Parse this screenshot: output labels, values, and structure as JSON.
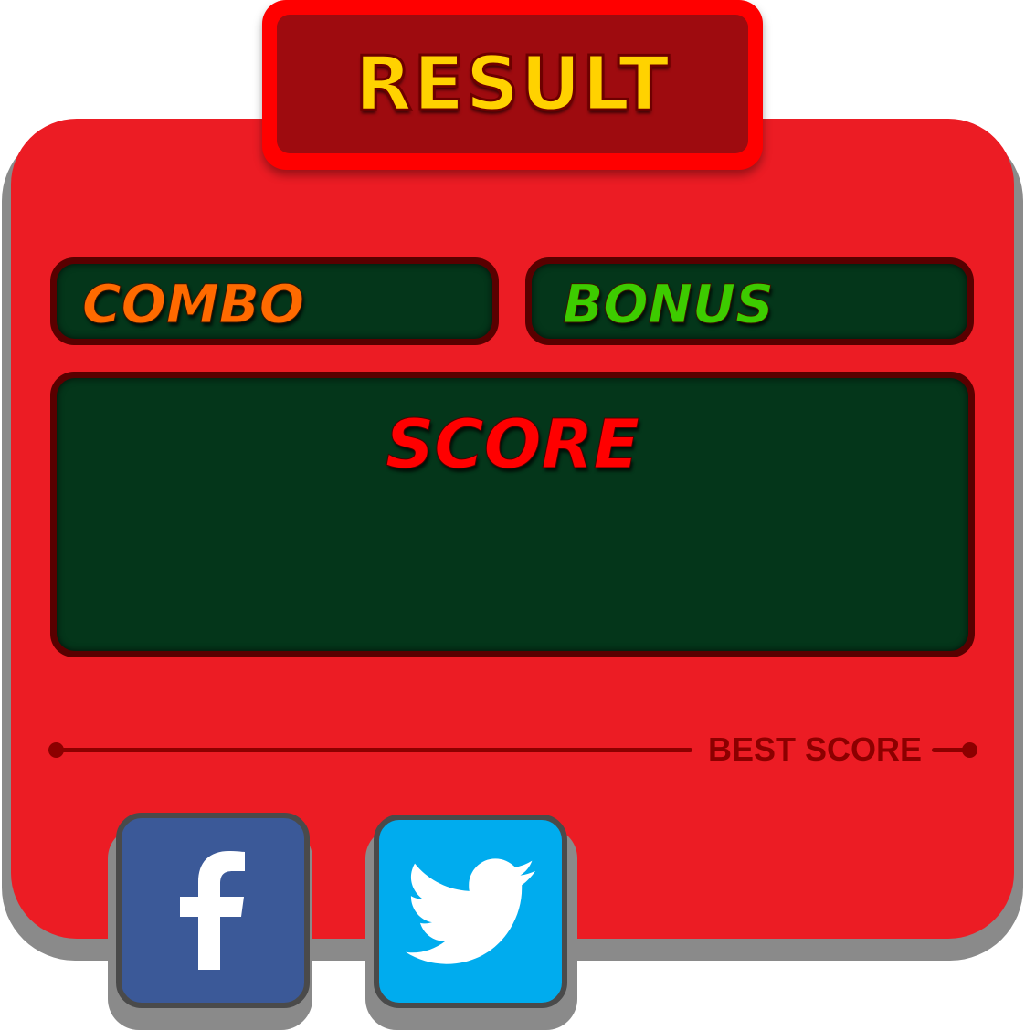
{
  "header": {
    "title": "RESULT"
  },
  "stats": {
    "combo_label": "COMBO",
    "bonus_label": "BONUS",
    "score_label": "SCORE"
  },
  "best_score": {
    "label": "BEST SCORE"
  },
  "social": {
    "facebook_icon": "facebook-icon",
    "twitter_icon": "twitter-icon"
  },
  "colors": {
    "panel": "#ec1c24",
    "header": "#9e0b0f",
    "title": "#ffd200",
    "box": "#04361a",
    "combo": "#ff6a00",
    "bonus": "#3dcc00",
    "score": "#ff0000",
    "facebook": "#3b5998",
    "twitter": "#00acee"
  }
}
